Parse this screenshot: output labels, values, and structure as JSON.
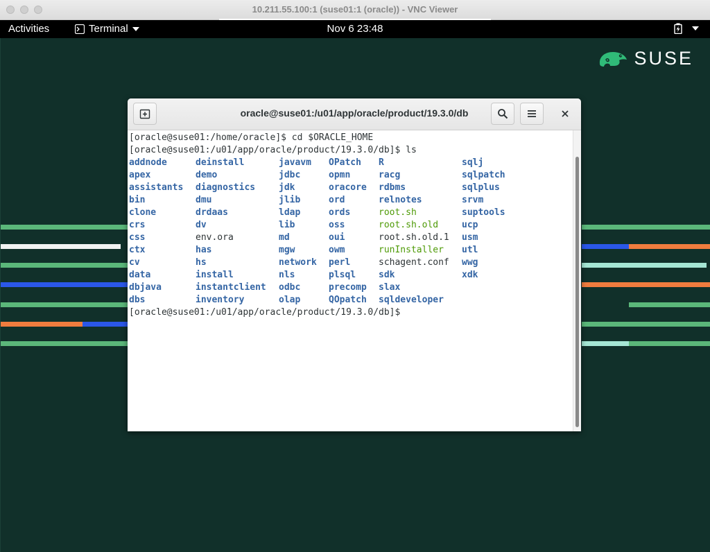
{
  "vnc": {
    "title": "10.211.55.100:1 (suse01:1 (oracle)) - VNC Viewer"
  },
  "topbar": {
    "activities": "Activities",
    "app_menu": "Terminal",
    "clock": "Nov 6  23:48"
  },
  "desktop": {
    "logo_text": "SUSE",
    "logo_icon": "chameleon-icon"
  },
  "terminal": {
    "title": "oracle@suse01:/u01/app/oracle/product/19.3.0/db",
    "lines": [
      "[oracle@suse01:/home/oracle]$ cd $ORACLE_HOME",
      "[oracle@suse01:/u01/app/oracle/product/19.3.0/db]$ ls"
    ],
    "prompt_after": "[oracle@suse01:/u01/app/oracle/product/19.3.0/db]$ ",
    "ls_colors": {
      "dir": "#3465a4",
      "exe": "#4e9a06",
      "file": "#2e3436"
    },
    "ls_columns": [
      [
        {
          "n": "addnode",
          "t": "dir"
        },
        {
          "n": "apex",
          "t": "dir"
        },
        {
          "n": "assistants",
          "t": "dir"
        },
        {
          "n": "bin",
          "t": "dir"
        },
        {
          "n": "clone",
          "t": "dir"
        },
        {
          "n": "crs",
          "t": "dir"
        },
        {
          "n": "css",
          "t": "dir"
        },
        {
          "n": "ctx",
          "t": "dir"
        },
        {
          "n": "cv",
          "t": "dir"
        },
        {
          "n": "data",
          "t": "dir"
        },
        {
          "n": "dbjava",
          "t": "dir"
        },
        {
          "n": "dbs",
          "t": "dir"
        }
      ],
      [
        {
          "n": "deinstall",
          "t": "dir"
        },
        {
          "n": "demo",
          "t": "dir"
        },
        {
          "n": "diagnostics",
          "t": "dir"
        },
        {
          "n": "dmu",
          "t": "dir"
        },
        {
          "n": "drdaas",
          "t": "dir"
        },
        {
          "n": "dv",
          "t": "dir"
        },
        {
          "n": "env.ora",
          "t": "file"
        },
        {
          "n": "has",
          "t": "dir"
        },
        {
          "n": "hs",
          "t": "dir"
        },
        {
          "n": "install",
          "t": "dir"
        },
        {
          "n": "instantclient",
          "t": "dir"
        },
        {
          "n": "inventory",
          "t": "dir"
        }
      ],
      [
        {
          "n": "javavm",
          "t": "dir"
        },
        {
          "n": "jdbc",
          "t": "dir"
        },
        {
          "n": "jdk",
          "t": "dir"
        },
        {
          "n": "jlib",
          "t": "dir"
        },
        {
          "n": "ldap",
          "t": "dir"
        },
        {
          "n": "lib",
          "t": "dir"
        },
        {
          "n": "md",
          "t": "dir"
        },
        {
          "n": "mgw",
          "t": "dir"
        },
        {
          "n": "network",
          "t": "dir"
        },
        {
          "n": "nls",
          "t": "dir"
        },
        {
          "n": "odbc",
          "t": "dir"
        },
        {
          "n": "olap",
          "t": "dir"
        }
      ],
      [
        {
          "n": "OPatch",
          "t": "dir"
        },
        {
          "n": "opmn",
          "t": "dir"
        },
        {
          "n": "oracore",
          "t": "dir"
        },
        {
          "n": "ord",
          "t": "dir"
        },
        {
          "n": "ords",
          "t": "dir"
        },
        {
          "n": "oss",
          "t": "dir"
        },
        {
          "n": "oui",
          "t": "dir"
        },
        {
          "n": "owm",
          "t": "dir"
        },
        {
          "n": "perl",
          "t": "dir"
        },
        {
          "n": "plsql",
          "t": "dir"
        },
        {
          "n": "precomp",
          "t": "dir"
        },
        {
          "n": "QOpatch",
          "t": "dir"
        }
      ],
      [
        {
          "n": "R",
          "t": "dir"
        },
        {
          "n": "racg",
          "t": "dir"
        },
        {
          "n": "rdbms",
          "t": "dir"
        },
        {
          "n": "relnotes",
          "t": "dir"
        },
        {
          "n": "root.sh",
          "t": "exe"
        },
        {
          "n": "root.sh.old",
          "t": "exe"
        },
        {
          "n": "root.sh.old.1",
          "t": "file"
        },
        {
          "n": "runInstaller",
          "t": "exe"
        },
        {
          "n": "schagent.conf",
          "t": "file"
        },
        {
          "n": "sdk",
          "t": "dir"
        },
        {
          "n": "slax",
          "t": "dir"
        },
        {
          "n": "sqldeveloper",
          "t": "dir"
        }
      ],
      [
        {
          "n": "sqlj",
          "t": "dir"
        },
        {
          "n": "sqlpatch",
          "t": "dir"
        },
        {
          "n": "sqlplus",
          "t": "dir"
        },
        {
          "n": "srvm",
          "t": "dir"
        },
        {
          "n": "suptools",
          "t": "dir"
        },
        {
          "n": "ucp",
          "t": "dir"
        },
        {
          "n": "usm",
          "t": "dir"
        },
        {
          "n": "utl",
          "t": "dir"
        },
        {
          "n": "wwg",
          "t": "dir"
        },
        {
          "n": "xdk",
          "t": "dir"
        }
      ]
    ],
    "header_buttons": {
      "new_tab_icon": "new-tab-icon",
      "search_icon": "search-icon",
      "menu_icon": "hamburger-menu-icon",
      "close_icon": "close-icon"
    }
  }
}
